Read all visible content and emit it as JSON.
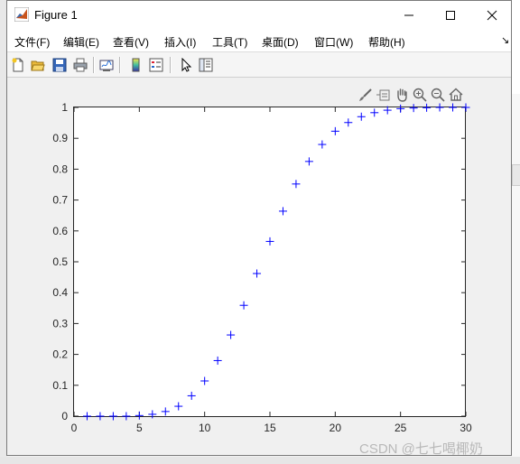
{
  "window": {
    "title": "Figure 1"
  },
  "menu": [
    {
      "label": "文件(F)",
      "key": "file"
    },
    {
      "label": "编辑(E)",
      "key": "edit"
    },
    {
      "label": "查看(V)",
      "key": "view"
    },
    {
      "label": "插入(I)",
      "key": "insert"
    },
    {
      "label": "工具(T)",
      "key": "tools"
    },
    {
      "label": "桌面(D)",
      "key": "desktop"
    },
    {
      "label": "窗口(W)",
      "key": "window"
    },
    {
      "label": "帮助(H)",
      "key": "help"
    }
  ],
  "toolbar_icons": [
    "new-figure-icon",
    "open-file-icon",
    "save-icon",
    "print-icon",
    "link-plot-icon",
    "colorbar-icon",
    "legend-icon",
    "edit-plot-icon",
    "property-inspector-icon"
  ],
  "axes_toolbar_icons": [
    "brush-icon",
    "datatip-icon",
    "pan-icon",
    "zoom-in-icon",
    "zoom-out-icon",
    "home-icon"
  ],
  "colors": {
    "marker": "#0000ff",
    "axes_bg": "#ffffff"
  },
  "watermark": "CSDN @七七喝椰奶",
  "chart_data": {
    "type": "scatter",
    "marker": "+",
    "x": [
      1,
      2,
      3,
      4,
      5,
      6,
      7,
      8,
      9,
      10,
      11,
      12,
      13,
      14,
      15,
      16,
      17,
      18,
      19,
      20,
      21,
      22,
      23,
      24,
      25,
      26,
      27,
      28,
      29,
      30
    ],
    "y": [
      0,
      0,
      0,
      0,
      0.002,
      0.006,
      0.015,
      0.032,
      0.066,
      0.114,
      0.18,
      0.263,
      0.359,
      0.462,
      0.566,
      0.664,
      0.752,
      0.825,
      0.88,
      0.923,
      0.951,
      0.97,
      0.983,
      0.991,
      0.996,
      0.998,
      0.999,
      1,
      1,
      1
    ],
    "xlim": [
      0,
      30
    ],
    "ylim": [
      0,
      1
    ],
    "xticks": [
      "0",
      "5",
      "10",
      "15",
      "20",
      "25",
      "30"
    ],
    "yticks": [
      "0",
      "0.1",
      "0.2",
      "0.3",
      "0.4",
      "0.5",
      "0.6",
      "0.7",
      "0.8",
      "0.9",
      "1"
    ],
    "grid": false
  }
}
